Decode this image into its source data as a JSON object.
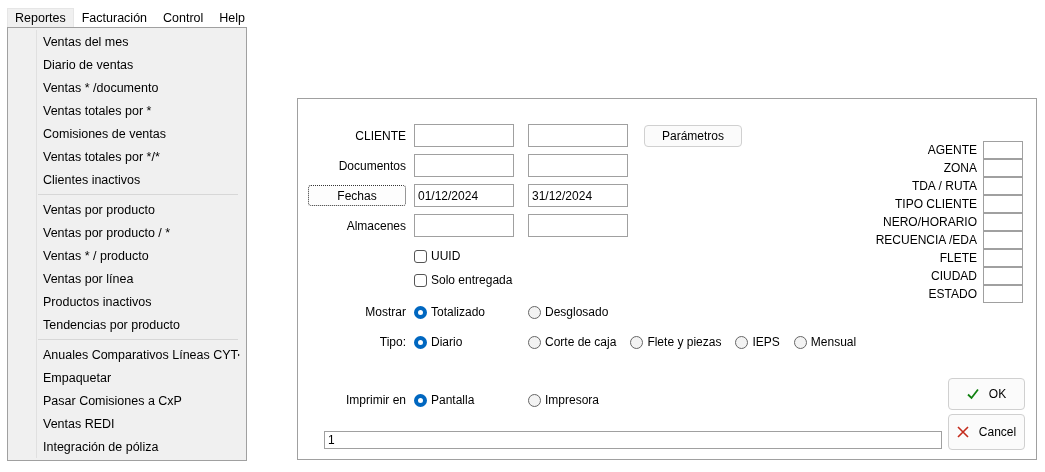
{
  "menubar": [
    {
      "label": "Reportes",
      "selected": true
    },
    {
      "label": "Facturación",
      "selected": false
    },
    {
      "label": "Control",
      "selected": false
    },
    {
      "label": "Help",
      "selected": false
    }
  ],
  "menu": {
    "groups": [
      [
        {
          "label": "Ventas del mes",
          "has_submenu": false
        },
        {
          "label": "Diario de ventas",
          "has_submenu": false
        },
        {
          "label": "Ventas * /documento",
          "has_submenu": false
        },
        {
          "label": "Ventas totales por *",
          "has_submenu": false
        },
        {
          "label": "Comisiones de ventas",
          "has_submenu": false
        },
        {
          "label": "Ventas totales por */*",
          "has_submenu": false
        },
        {
          "label": "Clientes inactivos",
          "has_submenu": false
        }
      ],
      [
        {
          "label": "Ventas por producto",
          "has_submenu": false
        },
        {
          "label": "Ventas por producto / *",
          "has_submenu": false
        },
        {
          "label": "Ventas * / producto",
          "has_submenu": false
        },
        {
          "label": "Ventas por línea",
          "has_submenu": false
        },
        {
          "label": "Productos inactivos",
          "has_submenu": false
        },
        {
          "label": "Tendencias por producto",
          "has_submenu": false
        }
      ],
      [
        {
          "label": "Anuales Comparativos Líneas CYT",
          "has_submenu": true
        },
        {
          "label": "Empaquetar",
          "has_submenu": false
        },
        {
          "label": "Pasar Comisiones a CxP",
          "has_submenu": false
        },
        {
          "label": "Ventas REDI",
          "has_submenu": false
        },
        {
          "label": "Integración de póliza",
          "has_submenu": false
        }
      ]
    ]
  },
  "dialog": {
    "fields": [
      {
        "label": "CLIENTE",
        "kind": "label"
      },
      {
        "label": "Documentos",
        "kind": "label"
      },
      {
        "label": "Fechas",
        "kind": "button",
        "focused": true,
        "from": "01/12/2024",
        "to": "31/12/2024"
      },
      {
        "label": "Almacenes",
        "kind": "label"
      }
    ],
    "parameters_button": "Parámetros",
    "checkboxes": [
      {
        "label": "UUID",
        "checked": false
      },
      {
        "label": "Solo entregada",
        "checked": false
      }
    ],
    "radio_groups": [
      {
        "label": "Mostrar",
        "options": [
          {
            "label": "Totalizado",
            "selected": true
          },
          {
            "label": "Desglosado",
            "selected": false
          }
        ]
      },
      {
        "label": "Tipo:",
        "options": [
          {
            "label": "Diario",
            "selected": true
          },
          {
            "label": "Corte de caja",
            "selected": false
          },
          {
            "label": "Flete y piezas",
            "selected": false
          },
          {
            "label": "IEPS",
            "selected": false
          },
          {
            "label": "Mensual",
            "selected": false
          }
        ]
      }
    ],
    "print_to": {
      "label": "Imprimir en",
      "options": [
        {
          "label": "Pantalla",
          "selected": true
        },
        {
          "label": "Impresora",
          "selected": false
        }
      ]
    },
    "status_field": {
      "value": "1"
    },
    "filters": [
      {
        "label": "AGENTE"
      },
      {
        "label": "ZONA"
      },
      {
        "label": "TDA / RUTA"
      },
      {
        "label": "TIPO CLIENTE"
      },
      {
        "label": "NERO/HORARIO"
      },
      {
        "label": "RECUENCIA /EDA"
      },
      {
        "label": "FLETE"
      },
      {
        "label": "CIUDAD"
      },
      {
        "label": "ESTADO"
      }
    ],
    "buttons": [
      {
        "label": "OK",
        "kind": "ok"
      },
      {
        "label": "Cancel",
        "kind": "cancel"
      }
    ]
  }
}
